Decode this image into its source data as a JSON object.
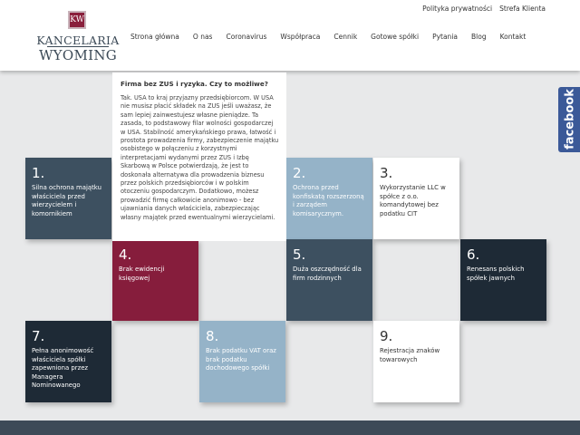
{
  "header": {
    "logo": {
      "mark": "KW",
      "line1": "KANCELARIA",
      "line2": "WYOMING"
    },
    "top_links": [
      "Polityka prywatności",
      "Strefa Klienta"
    ],
    "nav": [
      "Strona główna",
      "O nas",
      "Coronavirus",
      "Współpraca",
      "Cennik",
      "Gotowe spółki",
      "Pytania",
      "Blog",
      "Kontakt"
    ]
  },
  "facebook": {
    "label": "facebook",
    "color": "#3b5998"
  },
  "popup": {
    "title": "Firma bez ZUS i ryzyka. Czy to możliwe?",
    "body": "Tak. USA to kraj przyjazny przedsiębiorcom. W USA nie musisz płacić składek na ZUS jeśli uważasz, że sam lepiej zainwestujesz własne pieniądze. Ta zasada, to podstawowy filar wolności gospodarczej w USA. Stabilność amerykańskiego prawa, łatwość i prostota prowadzenia firmy, zabezpieczenie majątku osobistego w połączeniu z korzystnymi interpretacjami wydanymi przez ZUS i Izbę Skarbową w Polsce potwierdzają, że jest to doskonała alternatywa dla prowadzenia biznesu przez polskich przedsiębiorców i w polskim otoczeniu gospodarczym. Dodatkowo, możesz prowadzić firmę całkowicie anonimowo - bez ujawniania danych właściciela, zabezpieczając własny majątek przed ewentualnymi wierzycielami."
  },
  "tiles": [
    {
      "num": "1.",
      "text": "Silna ochrona majątku właściciela przed wierzycielem i komornikiem"
    },
    {
      "num": "2.",
      "text": "Ochrona przed konfiskatą rozszerzoną i zarządem komisarycznym."
    },
    {
      "num": "3.",
      "text": "Wykorzystanie LLC w spółce z o.o. komandytowej bez podatku CIT"
    },
    {
      "num": "4.",
      "text": "Brak ewidencji księgowej"
    },
    {
      "num": "5.",
      "text": "Duża oszczędność dla firm rodzinnych"
    },
    {
      "num": "6.",
      "text": "Renesans polskich spółek jawnych"
    },
    {
      "num": "7.",
      "text": "Pełna anonimowość właściciela spółki zapewniona przez Managera Nominowanego"
    },
    {
      "num": "8.",
      "text": "Brak podatku VAT oraz brak podatku dochodowego spółki"
    },
    {
      "num": "9.",
      "text": "Rejestracja znaków towarowych"
    }
  ],
  "colors": {
    "dark_slate": "#3d5060",
    "light_blue": "#95b3c8",
    "maroon": "#861d3c",
    "navy": "#1e2a36",
    "background": "#e8e9ea"
  }
}
